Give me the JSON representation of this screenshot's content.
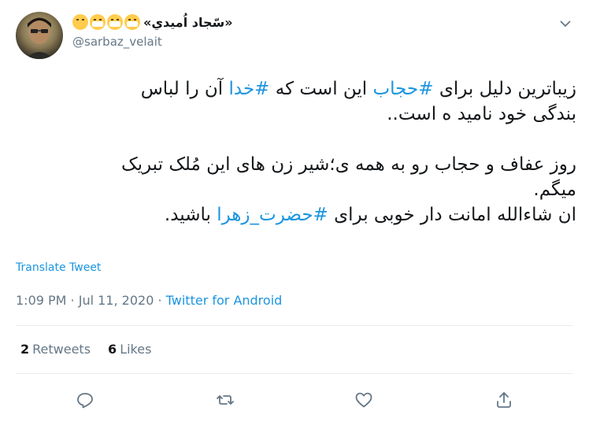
{
  "author": {
    "display_name": "«سّجاد اُميدي»",
    "emojis": [
      "relieved-face",
      "mask-face",
      "mask-face",
      "mask-face"
    ],
    "handle": "@sarbaz_velait"
  },
  "tweet": {
    "lines": [
      [
        {
          "text": "زیباترین دلیل برای ",
          "tag": false
        },
        {
          "text": "#حجاب",
          "tag": true
        },
        {
          "text": " این است که ",
          "tag": false
        },
        {
          "text": "#خدا",
          "tag": true
        },
        {
          "text": " آن را لباس",
          "tag": false
        }
      ],
      [
        {
          "text": "بندگی خود نامید ه است..",
          "tag": false
        }
      ],
      [],
      [
        {
          "text": "روز عفاف و حجاب رو به همه ی؛شیر زن های این مُلک تبریک",
          "tag": false
        }
      ],
      [
        {
          "text": "میگم.",
          "tag": false
        }
      ],
      [
        {
          "text": "ان شاءالله امانت دار خوبی برای ",
          "tag": false
        },
        {
          "text": "#حضرت_زهرا",
          "tag": true
        },
        {
          "text": " باشید.",
          "tag": false
        }
      ]
    ],
    "translate_label": "Translate Tweet",
    "time": "1:09 PM",
    "date": "Jul 11, 2020",
    "source": "Twitter for Android",
    "separator": " · "
  },
  "stats": {
    "retweets_count": "2",
    "retweets_label": "Retweets",
    "likes_count": "6",
    "likes_label": "Likes"
  },
  "actions": [
    "reply-icon",
    "retweet-icon",
    "like-icon",
    "share-icon"
  ],
  "colors": {
    "link": "#1b95e0",
    "secondary_text": "#657786",
    "primary_text": "#14171a",
    "divider": "#e6ecf0"
  }
}
